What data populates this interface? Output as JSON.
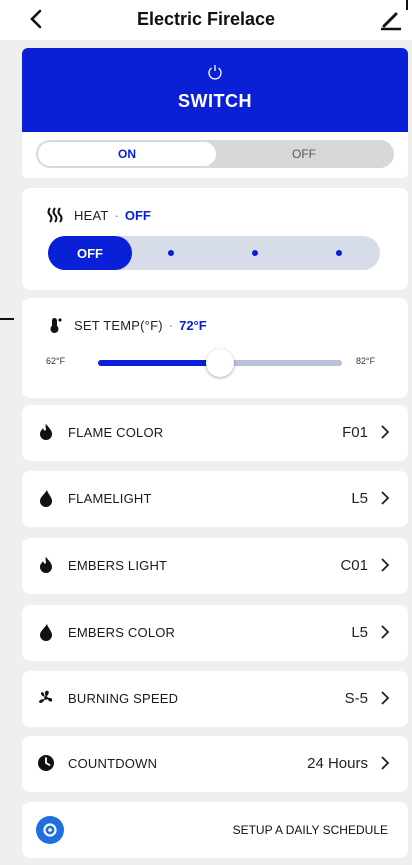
{
  "header": {
    "title": "Electric Firelace"
  },
  "switch": {
    "label": "SWITCH",
    "on_label": "ON",
    "off_label": "OFF",
    "state": "on"
  },
  "heat": {
    "label": "HEAT",
    "separator": "·",
    "value": "OFF",
    "off_option": "OFF",
    "level_count": 3
  },
  "temp": {
    "label": "SET TEMP(°F)",
    "separator": "·",
    "value": "72°F",
    "min_label": "62°F",
    "max_label": "82°F",
    "min": 62,
    "max": 82,
    "current": 72
  },
  "settings": [
    {
      "label": "FLAME COLOR",
      "value": "F01",
      "icon": "flame-icon"
    },
    {
      "label": "FLAMELIGHT",
      "value": "L5",
      "icon": "drop-icon"
    },
    {
      "label": "EMBERS LIGHT",
      "value": "C01",
      "icon": "flame-icon"
    },
    {
      "label": "EMBERS COLOR",
      "value": "L5",
      "icon": "drop-icon"
    },
    {
      "label": "BURNING SPEED",
      "value": "S-5",
      "icon": "fan-icon"
    },
    {
      "label": "COUNTDOWN",
      "value": "24 Hours",
      "icon": "clock-icon"
    }
  ],
  "schedule": {
    "label": "SETUP A DAILY SCHEDULE",
    "icon": "settings-icon"
  },
  "colors": {
    "accent": "#0a20d6",
    "background": "#efefef",
    "track": "#d6dde8",
    "schedule_icon": "#1f6fe0"
  }
}
